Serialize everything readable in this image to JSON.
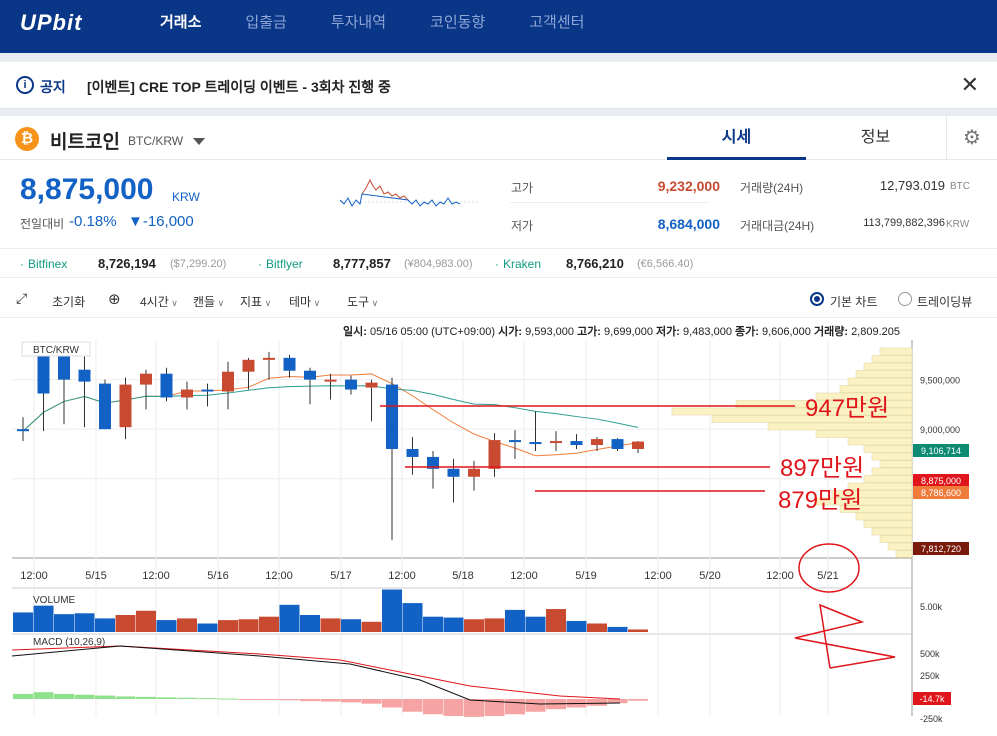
{
  "header": {
    "logo": "UPbit",
    "nav": [
      "거래소",
      "입출금",
      "투자내역",
      "코인동향",
      "고객센터"
    ],
    "active": "거래소"
  },
  "notice": {
    "label": "공지",
    "text": "[이벤트] CRE TOP 트레이딩 이벤트 - 3회차 진행 중",
    "close_icon": "close-icon"
  },
  "coin": {
    "icon_letter": "₿",
    "name": "비트코인",
    "pair": "BTC/KRW",
    "tab_price": "시세",
    "tab_info": "정보",
    "price": "8,875,000",
    "unit": "KRW",
    "change_label": "전일대비",
    "change_rate": "-0.18%",
    "change_amount": "▼-16,000",
    "high_label": "고가",
    "high": "9,232,000",
    "low_label": "저가",
    "low": "8,684,000",
    "vol_label": "거래량(24H)",
    "vol": "12,793.019",
    "vol_unit": "BTC",
    "amt_label": "거래대금(24H)",
    "amt": "113,799,882,396",
    "amt_unit": "KRW",
    "colors": {
      "up": "#c84a31",
      "down": "#1261c4",
      "brand": "#093687"
    }
  },
  "exchanges": [
    {
      "name": "Bitfinex",
      "price": "8,726,194",
      "sub": "($7,299.20)"
    },
    {
      "name": "Bitflyer",
      "price": "8,777,857",
      "sub": "(¥804,983.00)"
    },
    {
      "name": "Kraken",
      "price": "8,766,210",
      "sub": "(€6,566.40)"
    }
  ],
  "toolbar": {
    "reset": "초기화",
    "interval": "4시간",
    "candle": "캔들",
    "indicator": "지표",
    "theme": "테마",
    "tools": "도구",
    "basic_chart": "기본 차트",
    "tradingview": "트레이딩뷰"
  },
  "ohlc": {
    "time_label": "일시:",
    "time": "05/16 05:00 (UTC+09:00)",
    "open_label": "시가:",
    "open": "9,593,000",
    "high_label": "고가:",
    "high": "9,699,000",
    "low_label": "저가:",
    "low": "9,483,000",
    "close_label": "종가:",
    "close": "9,606,000",
    "vol_label": "거래량:",
    "vol": "2,809.205"
  },
  "chart_data": {
    "type": "candlestick",
    "title": "BTC/KRW",
    "x_ticks": [
      "12:00",
      "5/15",
      "12:00",
      "5/16",
      "12:00",
      "5/17",
      "12:00",
      "5/18",
      "12:00",
      "5/19",
      "12:00",
      "5/20",
      "12:00",
      "5/21"
    ],
    "y_ticks": [
      "9,500,000",
      "9,000,000",
      "8,500,000"
    ],
    "price_tags": [
      "9,106,714",
      "8,875,000",
      "8,786,600",
      "7,812,720"
    ],
    "annotations": [
      "947만원",
      "897만원",
      "879만원"
    ],
    "candles": [
      {
        "o": 9000000,
        "h": 9120000,
        "l": 8880000,
        "c": 8980000
      },
      {
        "o": 9820000,
        "h": 9880000,
        "l": 8980000,
        "c": 9360000
      },
      {
        "o": 9830000,
        "h": 9850000,
        "l": 9050000,
        "c": 9500000
      },
      {
        "o": 9600000,
        "h": 9750000,
        "l": 9020000,
        "c": 9480000
      },
      {
        "o": 9460000,
        "h": 9500000,
        "l": 9000000,
        "c": 9000000
      },
      {
        "o": 9020000,
        "h": 9520000,
        "l": 8900000,
        "c": 9450000
      },
      {
        "o": 9450000,
        "h": 9600000,
        "l": 9200000,
        "c": 9560000
      },
      {
        "o": 9560000,
        "h": 9620000,
        "l": 9280000,
        "c": 9320000
      },
      {
        "o": 9320000,
        "h": 9480000,
        "l": 9200000,
        "c": 9400000
      },
      {
        "o": 9400000,
        "h": 9460000,
        "l": 9230000,
        "c": 9380000
      },
      {
        "o": 9380000,
        "h": 9680000,
        "l": 9200000,
        "c": 9580000
      },
      {
        "o": 9580000,
        "h": 9720000,
        "l": 9400000,
        "c": 9700000
      },
      {
        "o": 9700000,
        "h": 9780000,
        "l": 9500000,
        "c": 9720000
      },
      {
        "o": 9720000,
        "h": 9750000,
        "l": 9520000,
        "c": 9590000
      },
      {
        "o": 9590000,
        "h": 9620000,
        "l": 9250000,
        "c": 9500000
      },
      {
        "o": 9500000,
        "h": 9560000,
        "l": 9300000,
        "c": 9500000
      },
      {
        "o": 9500000,
        "h": 9540000,
        "l": 9350000,
        "c": 9400000
      },
      {
        "o": 9420000,
        "h": 9500000,
        "l": 9080000,
        "c": 9470000
      },
      {
        "o": 9450000,
        "h": 9520000,
        "l": 7880000,
        "c": 8800000
      },
      {
        "o": 8800000,
        "h": 8920000,
        "l": 8540000,
        "c": 8720000
      },
      {
        "o": 8720000,
        "h": 8780000,
        "l": 8400000,
        "c": 8600000
      },
      {
        "o": 8600000,
        "h": 8700000,
        "l": 8260000,
        "c": 8520000
      },
      {
        "o": 8520000,
        "h": 8680000,
        "l": 8380000,
        "c": 8600000
      },
      {
        "o": 8600000,
        "h": 8960000,
        "l": 8520000,
        "c": 8890000
      },
      {
        "o": 8890000,
        "h": 8990000,
        "l": 8700000,
        "c": 8870000
      },
      {
        "o": 8870000,
        "h": 9180000,
        "l": 8780000,
        "c": 8860000
      },
      {
        "o": 8860000,
        "h": 8980000,
        "l": 8780000,
        "c": 8880000
      },
      {
        "o": 8880000,
        "h": 8950000,
        "l": 8800000,
        "c": 8840000
      },
      {
        "o": 8840000,
        "h": 8920000,
        "l": 8780000,
        "c": 8900000
      },
      {
        "o": 8900000,
        "h": 8910000,
        "l": 8780000,
        "c": 8800000
      },
      {
        "o": 8800000,
        "h": 8880000,
        "l": 8760000,
        "c": 8875000
      }
    ],
    "volume_label": "VOLUME",
    "volume_ticks": [
      "5.00k"
    ],
    "volume": [
      2.3,
      3.1,
      2.1,
      2.2,
      1.6,
      2.0,
      2.5,
      1.4,
      1.6,
      1.0,
      1.4,
      1.5,
      1.8,
      3.2,
      2.0,
      1.6,
      1.5,
      1.2,
      5.0,
      3.4,
      1.8,
      1.7,
      1.5,
      1.6,
      2.6,
      1.8,
      2.7,
      1.3,
      1.0,
      0.6,
      0.3
    ],
    "macd_label": "MACD (10,26,9)",
    "macd_ticks": [
      "500k",
      "250k",
      "-250k"
    ],
    "macd_tag": "-14.7k",
    "macd_hist": [
      60,
      80,
      60,
      50,
      40,
      30,
      25,
      20,
      15,
      10,
      5,
      -5,
      -10,
      -15,
      -25,
      -30,
      -40,
      -55,
      -100,
      -150,
      -180,
      -200,
      -210,
      -200,
      -180,
      -150,
      -120,
      -100,
      -80,
      -50,
      -20
    ]
  }
}
